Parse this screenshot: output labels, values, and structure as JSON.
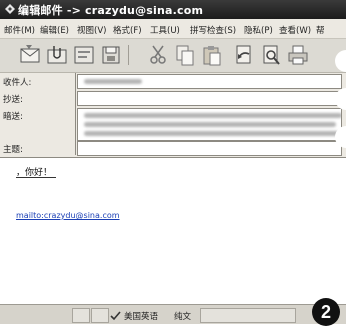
{
  "window": {
    "title": "编辑邮件 -> crazydu@sina.com"
  },
  "menu": {
    "items": [
      "邮件(M)",
      "编辑(E)",
      "视图(V)",
      "格式(F)",
      "工具(U)",
      "拼写检查(S)",
      "隐私(P)",
      "查看(W)",
      "帮"
    ]
  },
  "toolbar": {
    "icons": [
      "send-icon",
      "attach-icon",
      "address-book-icon",
      "save-icon",
      "cut-icon",
      "copy-icon",
      "paste-icon",
      "undo-icon",
      "redo-icon",
      "print-icon"
    ]
  },
  "compose": {
    "to_label": "收件人:",
    "cc_label": "抄送:",
    "bcc_label": "暗送:",
    "subject_label": "主题:",
    "to_value": "",
    "cc_value": "",
    "bcc_value": "",
    "subject_value": ""
  },
  "body": {
    "greeting": "，你好！",
    "signature_link": "mailto:crazydu@sina.com"
  },
  "statusbar": {
    "language": "美国英语",
    "mode": "纯文"
  },
  "annotation": {
    "badge_number": "2"
  }
}
